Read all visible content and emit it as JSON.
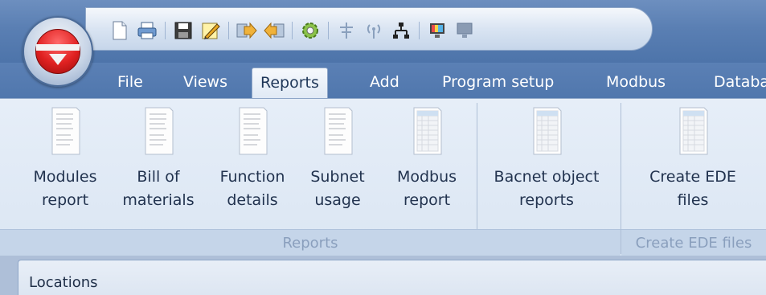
{
  "quick_access": {
    "icons": [
      "new-document-icon",
      "print-icon",
      "save-icon",
      "edit-icon",
      "send-icon",
      "receive-icon",
      "settings-gear-icon",
      "antenna-icon",
      "wireless-icon",
      "network-icon",
      "monitor-color-icon",
      "monitor-icon"
    ]
  },
  "tabs": [
    {
      "label": "File"
    },
    {
      "label": "Views"
    },
    {
      "label": "Reports",
      "active": true
    },
    {
      "label": "Add"
    },
    {
      "label": "Program setup"
    },
    {
      "label": "Modbus"
    },
    {
      "label": "Databa"
    }
  ],
  "ribbon": {
    "groups": [
      {
        "label": "Reports",
        "buttons": [
          {
            "label": "Modules\nreport",
            "icon": "text-report-icon"
          },
          {
            "label": "Bill of\nmaterials",
            "icon": "text-report-icon"
          },
          {
            "label": "Function\ndetails",
            "icon": "text-report-icon"
          },
          {
            "label": "Subnet\nusage",
            "icon": "text-report-icon"
          },
          {
            "label": "Modbus\nreport",
            "icon": "table-report-icon"
          },
          {
            "label": "Bacnet object\nreports",
            "icon": "table-report-icon"
          }
        ]
      },
      {
        "label": "Create EDE files",
        "buttons": [
          {
            "label": "Create EDE\nfiles",
            "icon": "table-report-icon"
          }
        ]
      }
    ]
  },
  "locations": {
    "title": "Locations"
  },
  "colors": {
    "accent": "#5a7fb3",
    "orb_red": "#e02121",
    "ribbon_bg": "#dbe6f3"
  }
}
